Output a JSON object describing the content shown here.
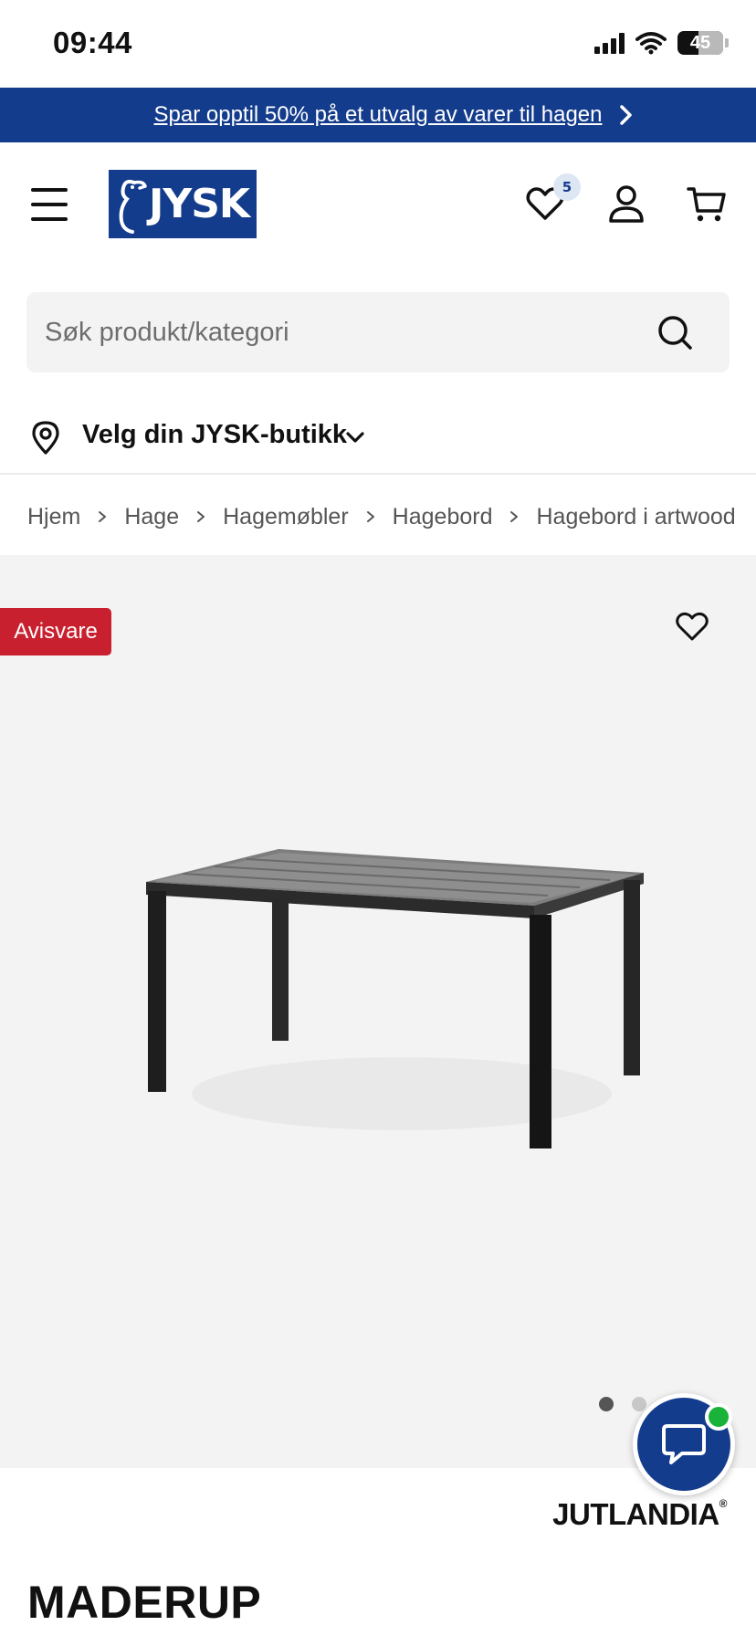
{
  "status_bar": {
    "time": "09:44",
    "battery_percent": 45,
    "battery_label": "45"
  },
  "promo_banner": {
    "text": "Spar opptil 50% på et utvalg av varer til hagen",
    "background": "#143c8c"
  },
  "header": {
    "logo_text": "JYSK",
    "wishlist_count": "5",
    "icons": [
      "menu-icon",
      "heart-icon",
      "account-icon",
      "cart-icon"
    ]
  },
  "search": {
    "placeholder": "Søk produkt/kategori"
  },
  "store_selector": {
    "label": "Velg din JYSK-butikk"
  },
  "breadcrumb": {
    "items": [
      "Hjem",
      "Hage",
      "Hagemøbler",
      "Hagebord",
      "Hagebord i artwood"
    ]
  },
  "product": {
    "badge": "Avisvare",
    "badge_color": "#c8202e",
    "brand": "JUTLANDIA",
    "brand_mark": "®",
    "title": "MADERUP",
    "image_count": 2,
    "active_image": 1
  },
  "chat": {
    "online_color": "#1ab33a"
  }
}
